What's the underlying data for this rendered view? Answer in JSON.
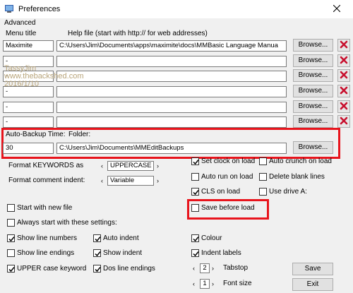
{
  "window": {
    "title": "Preferences"
  },
  "menu": {
    "items": [
      "Advanced"
    ]
  },
  "headers": {
    "menu_title": "Menu title",
    "help_file": "Help file  (start with http:// for web addresses)"
  },
  "rows": [
    {
      "title": "Maximite",
      "path": "C:\\Users\\Jim\\Documents\\apps\\maximite\\docs\\MMBasic Language Manua"
    },
    {
      "title": "-",
      "path": ""
    },
    {
      "title": "-",
      "path": ""
    },
    {
      "title": "-",
      "path": ""
    },
    {
      "title": "-",
      "path": ""
    },
    {
      "title": "-",
      "path": ""
    }
  ],
  "browse_label": "Browse...",
  "watermark": [
    "TassyJim",
    "www.thebackshed.com",
    "2016/1/10"
  ],
  "backup": {
    "time_label": "Auto-Backup Time:",
    "folder_label": "Folder:",
    "time_value": "30",
    "folder_value": "C:\\Users\\Jim\\Documents\\MMEditBackups"
  },
  "format_keywords": {
    "label": "Format KEYWORDS as",
    "value": "UPPERCASE"
  },
  "format_comment": {
    "label": "Format comment indent:",
    "value": "Variable"
  },
  "checks": {
    "set_clock": {
      "label": "Set clock on load",
      "checked": true
    },
    "auto_crunch": {
      "label": "Auto crunch on load",
      "checked": false
    },
    "auto_run": {
      "label": "Auto run on load",
      "checked": false
    },
    "delete_blank": {
      "label": "Delete blank lines",
      "checked": false
    },
    "cls_on_load": {
      "label": "CLS on load",
      "checked": true
    },
    "use_drive_a": {
      "label": "Use drive A:",
      "checked": false
    },
    "start_new_file": {
      "label": "Start with new file",
      "checked": false
    },
    "save_before_load": {
      "label": "Save before load",
      "checked": false
    },
    "always_start": {
      "label": "Always start with these settings:",
      "checked": false
    },
    "show_line_numbers": {
      "label": "Show line numbers",
      "checked": true
    },
    "auto_indent": {
      "label": "Auto indent",
      "checked": true
    },
    "colour": {
      "label": "Colour",
      "checked": true
    },
    "show_line_endings": {
      "label": "Show line endings",
      "checked": false
    },
    "show_indent": {
      "label": "Show indent",
      "checked": true
    },
    "indent_labels": {
      "label": "Indent labels",
      "checked": true
    },
    "upper_case_keyword": {
      "label": "UPPER case keyword",
      "checked": true
    },
    "dos_line_endings": {
      "label": "Dos line endings",
      "checked": true
    }
  },
  "tabstop": {
    "label": "Tabstop",
    "value": "2"
  },
  "fontsize": {
    "label": "Font size",
    "value": "1"
  },
  "buttons": {
    "save": "Save",
    "exit": "Exit"
  },
  "colors": {
    "highlight": "#e8141c",
    "delete_icon": "#c8102e"
  }
}
